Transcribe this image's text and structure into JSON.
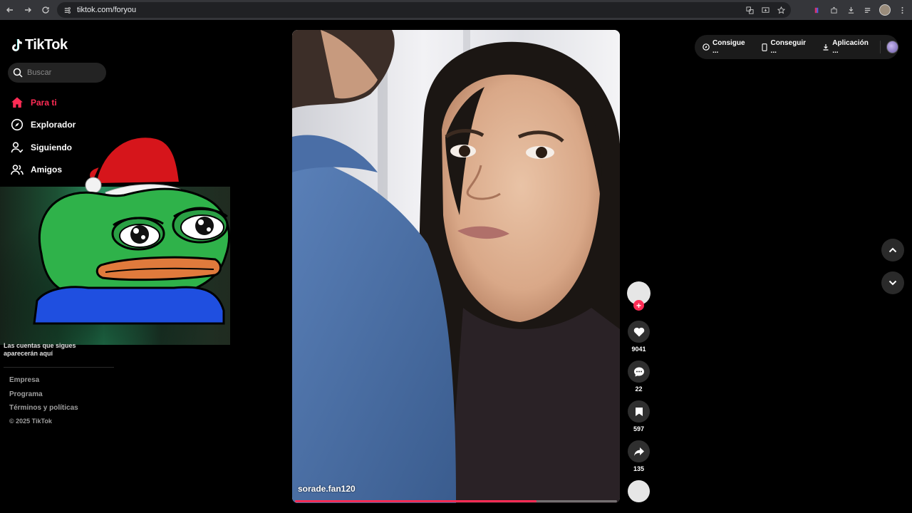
{
  "browser": {
    "url": "tiktok.com/foryou"
  },
  "sidebar": {
    "logo_text": "TikTok",
    "search_placeholder": "Buscar",
    "items": [
      {
        "label": "Para ti",
        "icon": "home-icon",
        "active": true
      },
      {
        "label": "Explorador",
        "icon": "compass-icon",
        "active": false
      },
      {
        "label": "Siguiendo",
        "icon": "user-follow-icon",
        "active": false
      },
      {
        "label": "Amigos",
        "icon": "friends-icon",
        "active": false
      }
    ],
    "following_note": "Las cuentas que sigues aparecerán aquí",
    "footer_links": [
      "Empresa",
      "Programa",
      "Términos y políticas"
    ],
    "copyright": "© 2025 TikTok"
  },
  "header": {
    "items": [
      {
        "label": "Consigue ...",
        "icon": "coin-icon"
      },
      {
        "label": "Conseguir ...",
        "icon": "phone-icon"
      },
      {
        "label": "Aplicación ...",
        "icon": "download-icon"
      }
    ]
  },
  "video": {
    "author": "sorade.fan120",
    "progress_fraction": 0.75
  },
  "actions": {
    "likes": "9041",
    "comments": "22",
    "saves": "597",
    "shares": "135"
  },
  "colors": {
    "accent": "#fe2c55",
    "background": "#000000"
  }
}
